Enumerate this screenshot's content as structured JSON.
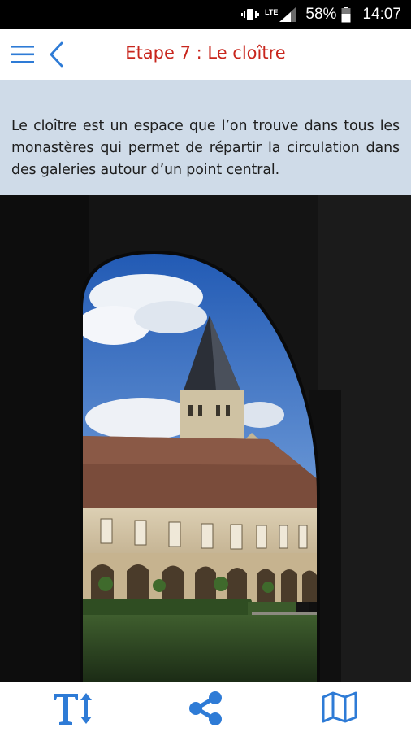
{
  "status_bar": {
    "network": "LTE",
    "battery_percent": "58%",
    "time": "14:07",
    "icons": [
      "vibrate-icon",
      "lte-signal-icon",
      "battery-icon"
    ]
  },
  "app_bar": {
    "title": "Etape 7 : Le cloître",
    "title_color": "#c8261d",
    "accent_color": "#2e7bd6",
    "icons": [
      "menu-icon",
      "back-arrow-icon"
    ]
  },
  "intro": {
    "text": "Le cloître est un espace que l’on trouve dans tous les monastères qui permet de répartir la circulation dans des galeries autour d’un point central.",
    "background": "#cfdbe8"
  },
  "photo": {
    "subject": "cloister-photo"
  },
  "bottom_bar": {
    "items": [
      {
        "icon": "text-size-icon"
      },
      {
        "icon": "share-icon"
      },
      {
        "icon": "map-icon"
      }
    ]
  }
}
